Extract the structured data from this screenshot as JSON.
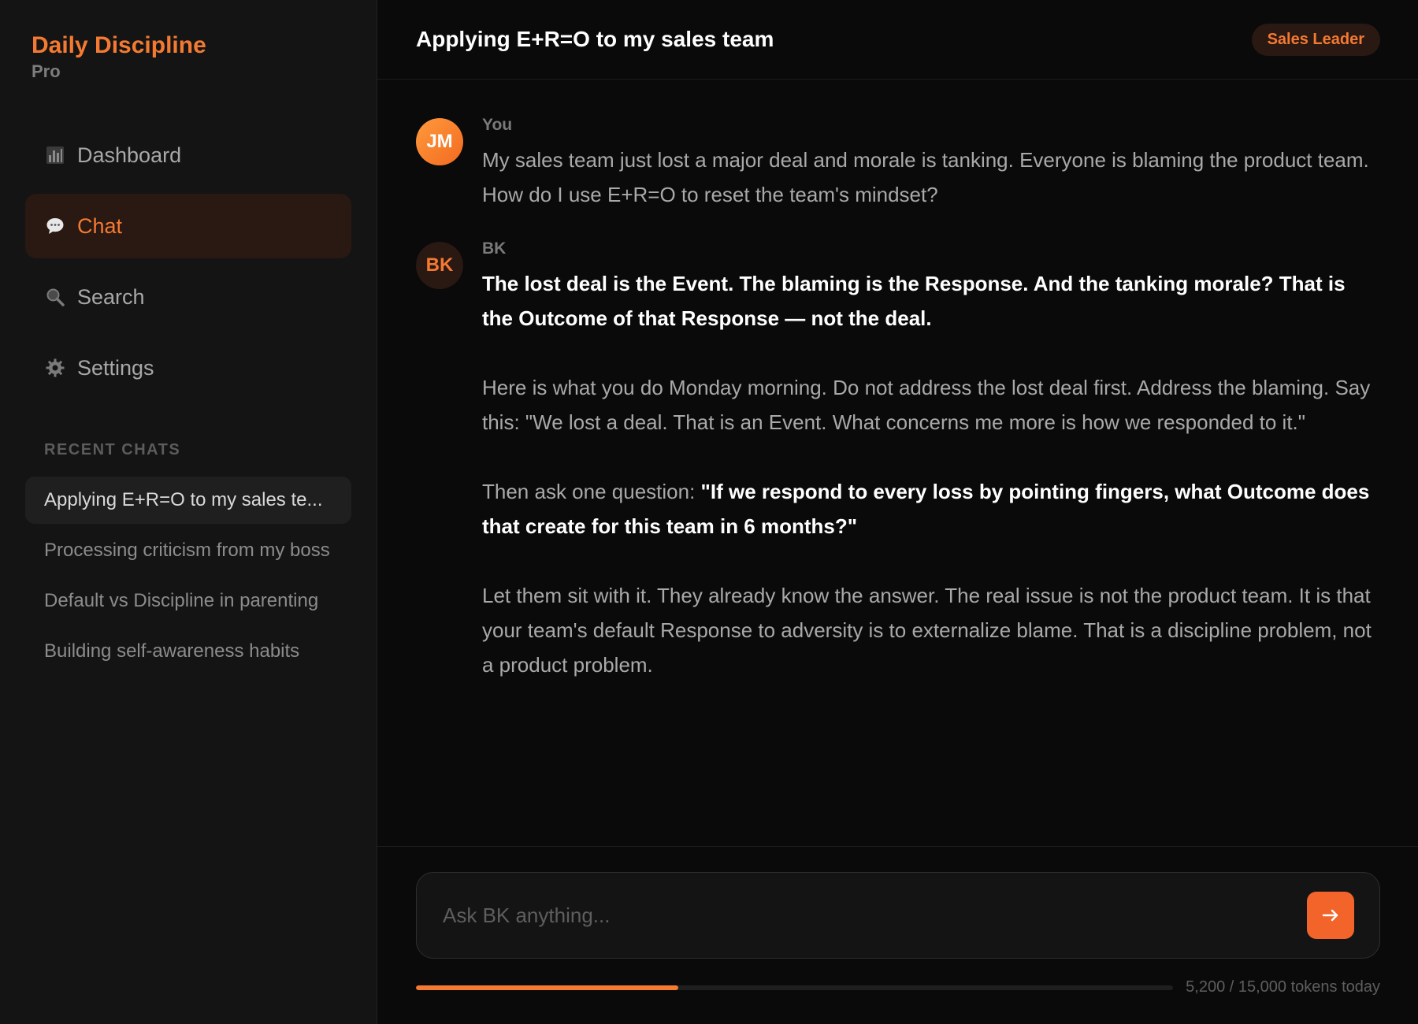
{
  "sidebar": {
    "brand_title": "Daily Discipline",
    "brand_sub": "Pro",
    "nav": [
      {
        "label": "Dashboard",
        "icon": "dashboard-icon"
      },
      {
        "label": "Chat",
        "icon": "chat-bubble-icon"
      },
      {
        "label": "Search",
        "icon": "search-icon"
      },
      {
        "label": "Settings",
        "icon": "gear-icon"
      }
    ],
    "active_nav": "Chat",
    "recent_heading": "RECENT CHATS",
    "recent": [
      {
        "label": "Applying E+R=O to my sales te..."
      },
      {
        "label": "Processing criticism from my boss"
      },
      {
        "label": "Default vs Discipline in parenting"
      },
      {
        "label": "Building self-awareness habits"
      }
    ]
  },
  "header": {
    "title": "Applying E+R=O to my sales team",
    "badge": "Sales Leader"
  },
  "messages": [
    {
      "avatar": "JM",
      "sender": "You",
      "text": "My sales team just lost a major deal and morale is tanking. Everyone is blaming the product team. How do I use E+R=O to reset the team's mindset?"
    },
    {
      "avatar": "BK",
      "sender": "BK",
      "p1_bold": "The lost deal is the Event. The blaming is the Response. And the tanking morale? That is the Outcome of that Response — not the deal.",
      "p2": "Here is what you do Monday morning. Do not address the lost deal first. Address the blaming. Say this: \"We lost a deal. That is an Event. What concerns me more is how we responded to it.\"",
      "p3_lead": "Then ask one question: ",
      "p3_bold": "\"If we respond to every loss by pointing fingers, what Outcome does that create for this team in 6 months?\"",
      "p4": "Let them sit with it. They already know the answer. The real issue is not the product team. It is that your team's default Response to adversity is to externalize blame. That is a discipline problem, not a product problem."
    }
  ],
  "composer": {
    "placeholder": "Ask BK anything...",
    "send_icon": "arrow-right-icon",
    "usage_text": "5,200 / 15,000 tokens today",
    "usage_fraction": 0.3467
  },
  "colors": {
    "accent": "#f47a32",
    "background": "#0a0a0a",
    "sidebar": "#141414"
  }
}
